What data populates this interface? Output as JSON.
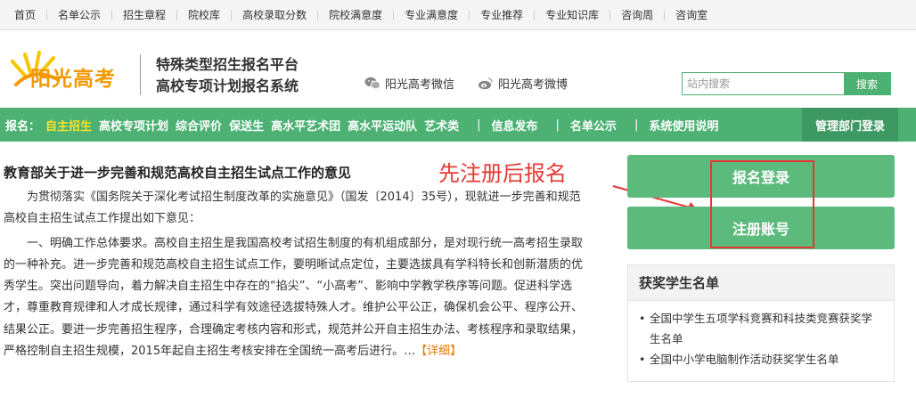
{
  "topnav": {
    "items": [
      "首页",
      "名单公示",
      "招生章程",
      "院校库",
      "高校录取分数",
      "院校满意度",
      "专业满意度",
      "专业推荐",
      "专业知识库",
      "咨询周",
      "咨询室"
    ]
  },
  "header": {
    "logo_text": "阳光高考",
    "platform_line1": "特殊类型招生报名平台",
    "platform_line2": "高校专项计划报名系统",
    "wechat_label": "阳光高考微信",
    "weibo_label": "阳光高考微博",
    "search_placeholder": "站内搜索",
    "search_button": "搜索"
  },
  "greennav": {
    "lead": "报名：",
    "items": [
      "自主招生",
      "高校专项计划",
      "综合评价",
      "保送生",
      "高水平艺术团",
      "高水平运动队",
      "艺术类"
    ],
    "info": "信息发布",
    "names": "名单公示",
    "guide": "系统使用说明",
    "admin": "管理部门登录"
  },
  "article": {
    "title": "教育部关于进一步完善和规范高校自主招生试点工作的意见",
    "para1": "为贯彻落实《国务院关于深化考试招生制度改革的实施意见》（国发〔2014〕35号），现就进一步完善和规范高校自主招生试点工作提出如下意见：",
    "para2": "一、明确工作总体要求。高校自主招生是我国高校考试招生制度的有机组成部分，是对现行统一高考招生录取的一种补充。进一步完善和规范高校自主招生试点工作，要明晰试点定位，主要选拔具有学科特长和创新潜质的优秀学生。突出问题导向，着力解决自主招生中存在的“掐尖”、“小高考”、影响中学教学秩序等问题。促进科学选才，尊重教育规律和人才成长规律，通过科学有效途径选拔特殊人才。维护公平公正，确保机会公平、程序公开、结果公正。要进一步完善招生程序，合理确定考核内容和形式，规范并公开自主招生办法、考核程序和录取结果，严格控制自主招生规模，2015年起自主招生考核安排在全国统一高考后进行。…",
    "more": "【详细】"
  },
  "annotation": {
    "text": "先注册后报名",
    "color": "#e53935"
  },
  "side": {
    "login": "报名登录",
    "register": "注册账号"
  },
  "awards": {
    "title": "获奖学生名单",
    "items": [
      "全国中学生五项学科竞赛和科技类竞赛获奖学生名单",
      "全国中小学电脑制作活动获奖学生名单"
    ]
  },
  "colors": {
    "brand_green": "#4cb173",
    "button_green": "#5cba7d",
    "accent_yellow": "#f7e22a",
    "logo_orange": "#f39800"
  }
}
